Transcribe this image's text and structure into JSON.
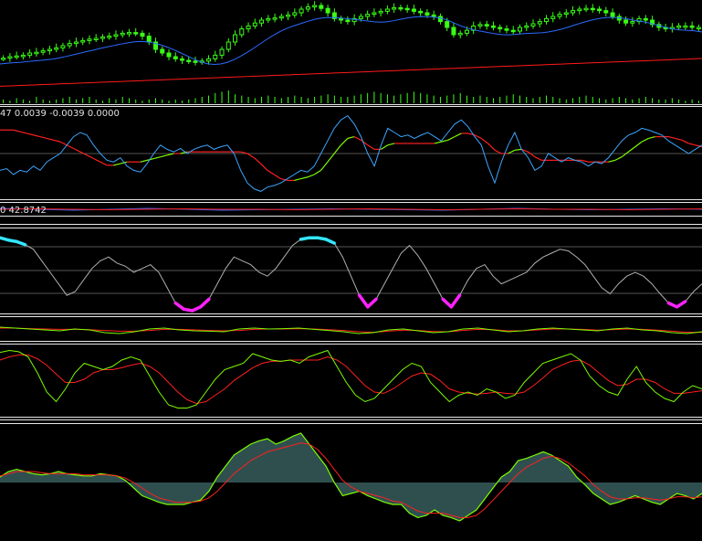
{
  "colors": {
    "background": "#000000",
    "candle": "#39ff14",
    "ma_fast": "#2b6bff",
    "ma_slow": "#ff1a1a",
    "volume": "#39ff14",
    "macd_main": "#3da5ff",
    "macd_signal_red": "#ff2020",
    "macd_signal_green": "#7cfc00",
    "osc_line": "#b0b0b0",
    "osc_high": "#33e6ff",
    "osc_low": "#ff22ff",
    "hist_fill": "#2f4f4f",
    "separator": "#e8e8e8"
  },
  "panels": {
    "macd_label": "47 0.0039 -0.0039 0.0000",
    "osc_label": "0 42.8742"
  },
  "chart_data": [
    {
      "panel": "price",
      "type": "candlestick",
      "overlays": [
        "ma-blue",
        "ma-red"
      ],
      "close": [
        0.28,
        0.3,
        0.31,
        0.32,
        0.35,
        0.36,
        0.38,
        0.4,
        0.42,
        0.45,
        0.48,
        0.5,
        0.52,
        0.54,
        0.55,
        0.57,
        0.58,
        0.6,
        0.62,
        0.63,
        0.62,
        0.58,
        0.5,
        0.4,
        0.35,
        0.3,
        0.27,
        0.25,
        0.24,
        0.23,
        0.24,
        0.27,
        0.32,
        0.4,
        0.5,
        0.6,
        0.68,
        0.72,
        0.76,
        0.8,
        0.82,
        0.83,
        0.85,
        0.87,
        0.9,
        0.95,
        0.98,
        1.0,
        0.96,
        0.9,
        0.82,
        0.8,
        0.78,
        0.82,
        0.85,
        0.88,
        0.9,
        0.92,
        0.95,
        0.97,
        0.96,
        0.95,
        0.92,
        0.9,
        0.87,
        0.85,
        0.78,
        0.7,
        0.6,
        0.62,
        0.66,
        0.72,
        0.74,
        0.72,
        0.7,
        0.68,
        0.66,
        0.65,
        0.7,
        0.72,
        0.75,
        0.78,
        0.82,
        0.85,
        0.88,
        0.9,
        0.93,
        0.95,
        0.96,
        0.95,
        0.93,
        0.9,
        0.85,
        0.8,
        0.76,
        0.78,
        0.82,
        0.8,
        0.74,
        0.7,
        0.68,
        0.7,
        0.72,
        0.72,
        0.7,
        0.7
      ]
    },
    {
      "panel": "volume",
      "type": "bar",
      "values": [
        0.3,
        0.2,
        0.4,
        0.3,
        0.2,
        0.5,
        0.3,
        0.2,
        0.3,
        0.4,
        0.5,
        0.3,
        0.4,
        0.5,
        0.3,
        0.2,
        0.4,
        0.3,
        0.5,
        0.4,
        0.3,
        0.2,
        0.3,
        0.4,
        0.3,
        0.2,
        0.3,
        0.2,
        0.3,
        0.4,
        0.5,
        0.6,
        0.8,
        0.9,
        1.0,
        0.7,
        0.6,
        0.5,
        0.4,
        0.5,
        0.6,
        0.5,
        0.4,
        0.5,
        0.6,
        0.5,
        0.4,
        0.5,
        0.6,
        0.7,
        0.6,
        0.5,
        0.5,
        0.6,
        0.7,
        0.8,
        0.9,
        0.8,
        0.7,
        0.6,
        0.7,
        0.8,
        0.9,
        0.8,
        0.7,
        0.6,
        0.5,
        0.6,
        0.7,
        0.8,
        0.6,
        0.5,
        0.6,
        0.5,
        0.4,
        0.5,
        0.6,
        0.7,
        0.6,
        0.5,
        0.4,
        0.5,
        0.6,
        0.5,
        0.4,
        0.3,
        0.4,
        0.5,
        0.6,
        0.5,
        0.4,
        0.3,
        0.4,
        0.5,
        0.4,
        0.3,
        0.4,
        0.5,
        0.4,
        0.3,
        0.3,
        0.4,
        0.3,
        0.2,
        0.3,
        0.2
      ]
    },
    {
      "panel": "macd",
      "type": "line",
      "series": [
        {
          "color_key": "macd_main",
          "values": [
            0.3,
            0.32,
            0.25,
            0.3,
            0.28,
            0.35,
            0.3,
            0.4,
            0.45,
            0.5,
            0.6,
            0.7,
            0.75,
            0.72,
            0.6,
            0.5,
            0.42,
            0.4,
            0.45,
            0.35,
            0.3,
            0.28,
            0.38,
            0.5,
            0.6,
            0.55,
            0.52,
            0.56,
            0.5,
            0.55,
            0.58,
            0.6,
            0.55,
            0.58,
            0.6,
            0.5,
            0.3,
            0.15,
            0.08,
            0.05,
            0.1,
            0.12,
            0.15,
            0.2,
            0.25,
            0.3,
            0.28,
            0.35,
            0.5,
            0.65,
            0.8,
            0.9,
            0.95,
            0.85,
            0.7,
            0.5,
            0.35,
            0.6,
            0.8,
            0.75,
            0.7,
            0.72,
            0.68,
            0.72,
            0.75,
            0.7,
            0.65,
            0.75,
            0.85,
            0.9,
            0.82,
            0.7,
            0.6,
            0.35,
            0.15,
            0.4,
            0.6,
            0.75,
            0.55,
            0.45,
            0.3,
            0.35,
            0.5,
            0.45,
            0.4,
            0.45,
            0.42,
            0.4,
            0.35,
            0.4,
            0.38,
            0.45,
            0.55,
            0.65,
            0.72,
            0.75,
            0.8,
            0.78,
            0.75,
            0.72,
            0.65,
            0.6,
            0.55,
            0.5,
            0.55,
            0.6
          ]
        },
        {
          "color_key": "macd_signal_red",
          "values": [
            0.78,
            0.78,
            0.78,
            0.76,
            0.74,
            0.72,
            0.7,
            0.68,
            0.66,
            0.64,
            0.6,
            0.56,
            0.52,
            0.48,
            0.44,
            0.4,
            0.36,
            0.36,
            0.38,
            0.4,
            0.4,
            0.4,
            0.42,
            0.44,
            0.46,
            0.48,
            0.5,
            0.5,
            0.52,
            0.52,
            0.52,
            0.52,
            0.52,
            0.52,
            0.52,
            0.52,
            0.52,
            0.5,
            0.45,
            0.38,
            0.3,
            0.25,
            0.2,
            0.18,
            0.18,
            0.2,
            0.22,
            0.25,
            0.3,
            0.4,
            0.5,
            0.6,
            0.68,
            0.7,
            0.66,
            0.6,
            0.55,
            0.55,
            0.6,
            0.62,
            0.62,
            0.62,
            0.62,
            0.62,
            0.62,
            0.62,
            0.64,
            0.66,
            0.7,
            0.74,
            0.74,
            0.72,
            0.68,
            0.62,
            0.54,
            0.5,
            0.5,
            0.54,
            0.55,
            0.52,
            0.46,
            0.42,
            0.42,
            0.42,
            0.42,
            0.42,
            0.42,
            0.42,
            0.4,
            0.4,
            0.4,
            0.4,
            0.42,
            0.46,
            0.52,
            0.58,
            0.64,
            0.68,
            0.7,
            0.7,
            0.7,
            0.68,
            0.66,
            0.62,
            0.6,
            0.58
          ]
        }
      ]
    },
    {
      "panel": "thin",
      "type": "line",
      "series": [
        {
          "color_key": "macd_main",
          "values": [
            0.6,
            0.5,
            0.4,
            0.5,
            0.6,
            0.5,
            0.4,
            0.45,
            0.5,
            0.55,
            0.5,
            0.45,
            0.4,
            0.5,
            0.6,
            0.5,
            0.45,
            0.5,
            0.55,
            0.5
          ]
        },
        {
          "color_key": "ma_slow",
          "values": [
            0.5,
            0.55,
            0.5,
            0.45,
            0.5,
            0.55,
            0.5,
            0.5,
            0.45,
            0.5,
            0.55,
            0.5,
            0.45,
            0.5,
            0.55,
            0.5,
            0.5,
            0.45,
            0.5,
            0.55
          ]
        }
      ]
    },
    {
      "panel": "oscillator",
      "type": "line",
      "levels": [
        80,
        50,
        20
      ],
      "series": [
        {
          "color_key": "osc_line",
          "values": [
            0.95,
            0.92,
            0.9,
            0.86,
            0.8,
            0.65,
            0.5,
            0.35,
            0.2,
            0.25,
            0.4,
            0.55,
            0.65,
            0.7,
            0.62,
            0.58,
            0.5,
            0.55,
            0.6,
            0.5,
            0.3,
            0.1,
            0.02,
            0.0,
            0.05,
            0.15,
            0.35,
            0.55,
            0.7,
            0.65,
            0.6,
            0.5,
            0.45,
            0.55,
            0.7,
            0.85,
            0.93,
            0.95,
            0.95,
            0.93,
            0.88,
            0.7,
            0.45,
            0.2,
            0.05,
            0.15,
            0.35,
            0.55,
            0.75,
            0.85,
            0.72,
            0.55,
            0.35,
            0.15,
            0.05,
            0.2,
            0.4,
            0.55,
            0.6,
            0.45,
            0.35,
            0.4,
            0.45,
            0.5,
            0.62,
            0.7,
            0.75,
            0.8,
            0.78,
            0.7,
            0.6,
            0.45,
            0.3,
            0.22,
            0.35,
            0.45,
            0.5,
            0.45,
            0.35,
            0.22,
            0.1,
            0.05,
            0.12,
            0.25,
            0.35
          ]
        }
      ]
    },
    {
      "panel": "stoch-a",
      "type": "line",
      "series": [
        {
          "color_key": "macd_signal_green",
          "values": [
            0.6,
            0.55,
            0.5,
            0.45,
            0.4,
            0.5,
            0.45,
            0.3,
            0.25,
            0.35,
            0.5,
            0.55,
            0.45,
            0.4,
            0.38,
            0.35,
            0.5,
            0.55,
            0.5,
            0.52,
            0.55,
            0.48,
            0.42,
            0.35,
            0.25,
            0.3,
            0.45,
            0.5,
            0.4,
            0.3,
            0.35,
            0.5,
            0.55,
            0.45,
            0.35,
            0.4,
            0.5,
            0.55,
            0.5,
            0.45,
            0.4,
            0.5,
            0.55,
            0.45,
            0.4,
            0.3,
            0.25,
            0.35
          ]
        },
        {
          "color_key": "macd_signal_red",
          "values": [
            0.55,
            0.55,
            0.52,
            0.5,
            0.48,
            0.48,
            0.46,
            0.42,
            0.38,
            0.38,
            0.42,
            0.48,
            0.48,
            0.45,
            0.42,
            0.4,
            0.42,
            0.48,
            0.5,
            0.5,
            0.52,
            0.5,
            0.46,
            0.42,
            0.35,
            0.32,
            0.38,
            0.44,
            0.42,
            0.36,
            0.35,
            0.42,
            0.48,
            0.46,
            0.4,
            0.4,
            0.45,
            0.5,
            0.5,
            0.48,
            0.44,
            0.46,
            0.5,
            0.48,
            0.44,
            0.38,
            0.32,
            0.32
          ]
        }
      ]
    },
    {
      "panel": "stoch-b",
      "type": "line",
      "series": [
        {
          "color_key": "macd_signal_green",
          "values": [
            0.92,
            0.95,
            0.93,
            0.85,
            0.6,
            0.3,
            0.15,
            0.35,
            0.6,
            0.75,
            0.7,
            0.65,
            0.7,
            0.8,
            0.85,
            0.8,
            0.55,
            0.3,
            0.1,
            0.05,
            0.05,
            0.1,
            0.3,
            0.5,
            0.65,
            0.7,
            0.75,
            0.9,
            0.85,
            0.8,
            0.78,
            0.8,
            0.75,
            0.85,
            0.9,
            0.95,
            0.7,
            0.45,
            0.25,
            0.15,
            0.2,
            0.35,
            0.5,
            0.65,
            0.75,
            0.7,
            0.45,
            0.3,
            0.15,
            0.25,
            0.3,
            0.25,
            0.35,
            0.3,
            0.2,
            0.25,
            0.45,
            0.6,
            0.75,
            0.8,
            0.85,
            0.9,
            0.8,
            0.55,
            0.4,
            0.3,
            0.25,
            0.5,
            0.7,
            0.45,
            0.3,
            0.2,
            0.15,
            0.3,
            0.4,
            0.35
          ]
        },
        {
          "color_key": "macd_signal_red",
          "values": [
            0.8,
            0.85,
            0.88,
            0.88,
            0.82,
            0.72,
            0.58,
            0.45,
            0.45,
            0.5,
            0.6,
            0.65,
            0.65,
            0.68,
            0.72,
            0.75,
            0.7,
            0.6,
            0.45,
            0.3,
            0.18,
            0.12,
            0.15,
            0.25,
            0.35,
            0.48,
            0.58,
            0.68,
            0.75,
            0.78,
            0.78,
            0.8,
            0.8,
            0.8,
            0.8,
            0.85,
            0.8,
            0.7,
            0.55,
            0.4,
            0.3,
            0.28,
            0.35,
            0.45,
            0.55,
            0.6,
            0.58,
            0.48,
            0.35,
            0.3,
            0.28,
            0.27,
            0.28,
            0.3,
            0.28,
            0.27,
            0.3,
            0.4,
            0.52,
            0.65,
            0.72,
            0.78,
            0.8,
            0.72,
            0.6,
            0.48,
            0.4,
            0.42,
            0.5,
            0.5,
            0.45,
            0.35,
            0.28,
            0.28,
            0.3,
            0.32
          ]
        }
      ]
    },
    {
      "panel": "histogram",
      "type": "area",
      "baseline": 0.5,
      "series": [
        {
          "color_key": "macd_signal_green",
          "values": [
            0.55,
            0.6,
            0.62,
            0.6,
            0.58,
            0.57,
            0.58,
            0.6,
            0.58,
            0.57,
            0.56,
            0.56,
            0.58,
            0.57,
            0.56,
            0.52,
            0.45,
            0.38,
            0.35,
            0.32,
            0.3,
            0.3,
            0.3,
            0.32,
            0.34,
            0.42,
            0.55,
            0.65,
            0.75,
            0.8,
            0.85,
            0.88,
            0.9,
            0.85,
            0.88,
            0.92,
            0.95,
            0.85,
            0.75,
            0.65,
            0.5,
            0.38,
            0.4,
            0.42,
            0.38,
            0.35,
            0.32,
            0.3,
            0.3,
            0.22,
            0.18,
            0.2,
            0.25,
            0.2,
            0.18,
            0.15,
            0.2,
            0.25,
            0.35,
            0.45,
            0.55,
            0.6,
            0.7,
            0.72,
            0.75,
            0.78,
            0.75,
            0.7,
            0.65,
            0.55,
            0.48,
            0.4,
            0.35,
            0.3,
            0.32,
            0.35,
            0.38,
            0.35,
            0.32,
            0.3,
            0.35,
            0.4,
            0.38,
            0.35,
            0.4
          ]
        },
        {
          "color_key": "macd_signal_red",
          "values": [
            0.56,
            0.58,
            0.6,
            0.6,
            0.6,
            0.59,
            0.58,
            0.58,
            0.58,
            0.58,
            0.57,
            0.57,
            0.57,
            0.57,
            0.56,
            0.54,
            0.5,
            0.45,
            0.4,
            0.36,
            0.34,
            0.32,
            0.32,
            0.32,
            0.33,
            0.36,
            0.42,
            0.5,
            0.58,
            0.64,
            0.7,
            0.74,
            0.78,
            0.8,
            0.82,
            0.84,
            0.86,
            0.85,
            0.8,
            0.72,
            0.62,
            0.52,
            0.46,
            0.42,
            0.4,
            0.38,
            0.36,
            0.33,
            0.32,
            0.28,
            0.24,
            0.22,
            0.22,
            0.22,
            0.2,
            0.18,
            0.18,
            0.2,
            0.26,
            0.34,
            0.42,
            0.5,
            0.58,
            0.64,
            0.68,
            0.72,
            0.74,
            0.72,
            0.68,
            0.62,
            0.56,
            0.48,
            0.42,
            0.37,
            0.35,
            0.35,
            0.36,
            0.36,
            0.35,
            0.34,
            0.35,
            0.37,
            0.37,
            0.36,
            0.37
          ]
        }
      ]
    }
  ]
}
